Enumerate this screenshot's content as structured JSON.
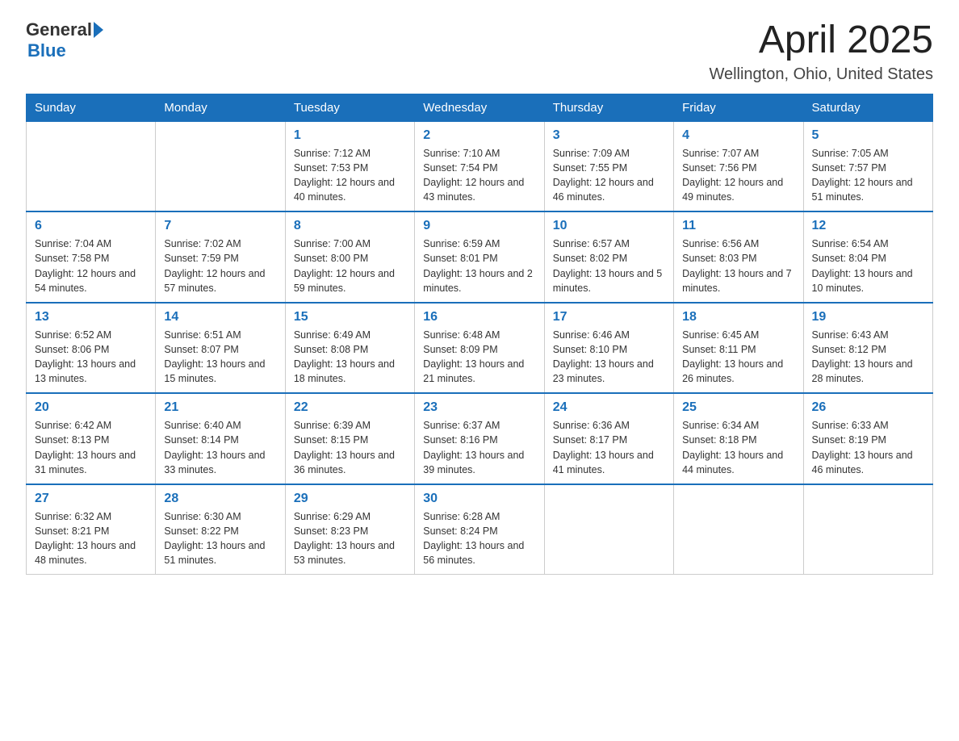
{
  "header": {
    "logo_general": "General",
    "logo_blue": "Blue",
    "month_title": "April 2025",
    "location": "Wellington, Ohio, United States"
  },
  "days_of_week": [
    "Sunday",
    "Monday",
    "Tuesday",
    "Wednesday",
    "Thursday",
    "Friday",
    "Saturday"
  ],
  "weeks": [
    [
      {
        "day": "",
        "sunrise": "",
        "sunset": "",
        "daylight": ""
      },
      {
        "day": "",
        "sunrise": "",
        "sunset": "",
        "daylight": ""
      },
      {
        "day": "1",
        "sunrise": "Sunrise: 7:12 AM",
        "sunset": "Sunset: 7:53 PM",
        "daylight": "Daylight: 12 hours and 40 minutes."
      },
      {
        "day": "2",
        "sunrise": "Sunrise: 7:10 AM",
        "sunset": "Sunset: 7:54 PM",
        "daylight": "Daylight: 12 hours and 43 minutes."
      },
      {
        "day": "3",
        "sunrise": "Sunrise: 7:09 AM",
        "sunset": "Sunset: 7:55 PM",
        "daylight": "Daylight: 12 hours and 46 minutes."
      },
      {
        "day": "4",
        "sunrise": "Sunrise: 7:07 AM",
        "sunset": "Sunset: 7:56 PM",
        "daylight": "Daylight: 12 hours and 49 minutes."
      },
      {
        "day": "5",
        "sunrise": "Sunrise: 7:05 AM",
        "sunset": "Sunset: 7:57 PM",
        "daylight": "Daylight: 12 hours and 51 minutes."
      }
    ],
    [
      {
        "day": "6",
        "sunrise": "Sunrise: 7:04 AM",
        "sunset": "Sunset: 7:58 PM",
        "daylight": "Daylight: 12 hours and 54 minutes."
      },
      {
        "day": "7",
        "sunrise": "Sunrise: 7:02 AM",
        "sunset": "Sunset: 7:59 PM",
        "daylight": "Daylight: 12 hours and 57 minutes."
      },
      {
        "day": "8",
        "sunrise": "Sunrise: 7:00 AM",
        "sunset": "Sunset: 8:00 PM",
        "daylight": "Daylight: 12 hours and 59 minutes."
      },
      {
        "day": "9",
        "sunrise": "Sunrise: 6:59 AM",
        "sunset": "Sunset: 8:01 PM",
        "daylight": "Daylight: 13 hours and 2 minutes."
      },
      {
        "day": "10",
        "sunrise": "Sunrise: 6:57 AM",
        "sunset": "Sunset: 8:02 PM",
        "daylight": "Daylight: 13 hours and 5 minutes."
      },
      {
        "day": "11",
        "sunrise": "Sunrise: 6:56 AM",
        "sunset": "Sunset: 8:03 PM",
        "daylight": "Daylight: 13 hours and 7 minutes."
      },
      {
        "day": "12",
        "sunrise": "Sunrise: 6:54 AM",
        "sunset": "Sunset: 8:04 PM",
        "daylight": "Daylight: 13 hours and 10 minutes."
      }
    ],
    [
      {
        "day": "13",
        "sunrise": "Sunrise: 6:52 AM",
        "sunset": "Sunset: 8:06 PM",
        "daylight": "Daylight: 13 hours and 13 minutes."
      },
      {
        "day": "14",
        "sunrise": "Sunrise: 6:51 AM",
        "sunset": "Sunset: 8:07 PM",
        "daylight": "Daylight: 13 hours and 15 minutes."
      },
      {
        "day": "15",
        "sunrise": "Sunrise: 6:49 AM",
        "sunset": "Sunset: 8:08 PM",
        "daylight": "Daylight: 13 hours and 18 minutes."
      },
      {
        "day": "16",
        "sunrise": "Sunrise: 6:48 AM",
        "sunset": "Sunset: 8:09 PM",
        "daylight": "Daylight: 13 hours and 21 minutes."
      },
      {
        "day": "17",
        "sunrise": "Sunrise: 6:46 AM",
        "sunset": "Sunset: 8:10 PM",
        "daylight": "Daylight: 13 hours and 23 minutes."
      },
      {
        "day": "18",
        "sunrise": "Sunrise: 6:45 AM",
        "sunset": "Sunset: 8:11 PM",
        "daylight": "Daylight: 13 hours and 26 minutes."
      },
      {
        "day": "19",
        "sunrise": "Sunrise: 6:43 AM",
        "sunset": "Sunset: 8:12 PM",
        "daylight": "Daylight: 13 hours and 28 minutes."
      }
    ],
    [
      {
        "day": "20",
        "sunrise": "Sunrise: 6:42 AM",
        "sunset": "Sunset: 8:13 PM",
        "daylight": "Daylight: 13 hours and 31 minutes."
      },
      {
        "day": "21",
        "sunrise": "Sunrise: 6:40 AM",
        "sunset": "Sunset: 8:14 PM",
        "daylight": "Daylight: 13 hours and 33 minutes."
      },
      {
        "day": "22",
        "sunrise": "Sunrise: 6:39 AM",
        "sunset": "Sunset: 8:15 PM",
        "daylight": "Daylight: 13 hours and 36 minutes."
      },
      {
        "day": "23",
        "sunrise": "Sunrise: 6:37 AM",
        "sunset": "Sunset: 8:16 PM",
        "daylight": "Daylight: 13 hours and 39 minutes."
      },
      {
        "day": "24",
        "sunrise": "Sunrise: 6:36 AM",
        "sunset": "Sunset: 8:17 PM",
        "daylight": "Daylight: 13 hours and 41 minutes."
      },
      {
        "day": "25",
        "sunrise": "Sunrise: 6:34 AM",
        "sunset": "Sunset: 8:18 PM",
        "daylight": "Daylight: 13 hours and 44 minutes."
      },
      {
        "day": "26",
        "sunrise": "Sunrise: 6:33 AM",
        "sunset": "Sunset: 8:19 PM",
        "daylight": "Daylight: 13 hours and 46 minutes."
      }
    ],
    [
      {
        "day": "27",
        "sunrise": "Sunrise: 6:32 AM",
        "sunset": "Sunset: 8:21 PM",
        "daylight": "Daylight: 13 hours and 48 minutes."
      },
      {
        "day": "28",
        "sunrise": "Sunrise: 6:30 AM",
        "sunset": "Sunset: 8:22 PM",
        "daylight": "Daylight: 13 hours and 51 minutes."
      },
      {
        "day": "29",
        "sunrise": "Sunrise: 6:29 AM",
        "sunset": "Sunset: 8:23 PM",
        "daylight": "Daylight: 13 hours and 53 minutes."
      },
      {
        "day": "30",
        "sunrise": "Sunrise: 6:28 AM",
        "sunset": "Sunset: 8:24 PM",
        "daylight": "Daylight: 13 hours and 56 minutes."
      },
      {
        "day": "",
        "sunrise": "",
        "sunset": "",
        "daylight": ""
      },
      {
        "day": "",
        "sunrise": "",
        "sunset": "",
        "daylight": ""
      },
      {
        "day": "",
        "sunrise": "",
        "sunset": "",
        "daylight": ""
      }
    ]
  ]
}
